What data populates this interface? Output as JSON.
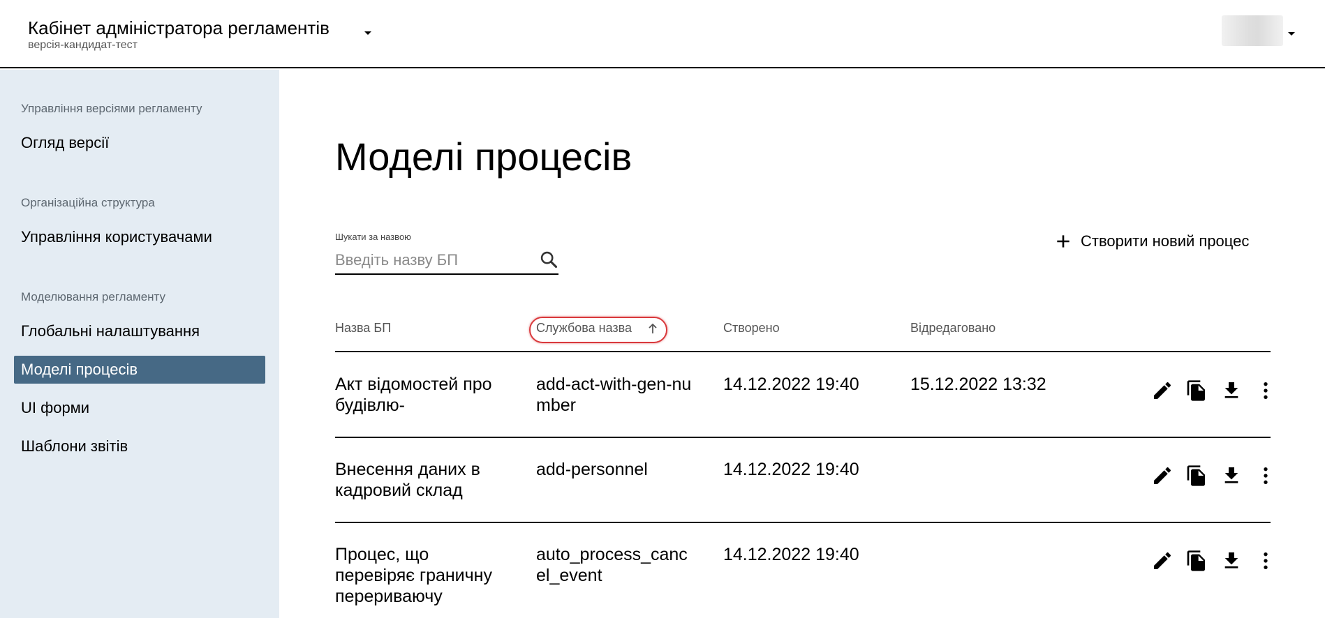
{
  "header": {
    "title": "Кабінет адміністратора регламентів",
    "subtitle": "версія-кандидат-тест"
  },
  "sidebar": {
    "sections": [
      {
        "label": "Управління версіями регламенту",
        "items": [
          "Огляд версії"
        ]
      },
      {
        "label": "Організаційна структура",
        "items": [
          "Управління користувачами"
        ]
      },
      {
        "label": "Моделювання регламенту",
        "items": [
          "Глобальні налаштування",
          "Моделі процесів",
          "UI форми",
          "Шаблони звітів"
        ]
      }
    ],
    "active_item": "Моделі процесів"
  },
  "main": {
    "title": "Моделі процесів",
    "search": {
      "label": "Шукати за назвою",
      "placeholder": "Введіть назву БП",
      "value": ""
    },
    "create_button": "Створити новий процес"
  },
  "table": {
    "columns": [
      "Назва БП",
      "Службова назва",
      "Створено",
      "Відредаговано"
    ],
    "sorted_column": "Службова назва",
    "sort_direction": "ascending",
    "rows": [
      {
        "name": "Акт відомостей про будівлю-",
        "service_name": "add-act-with-gen-number",
        "created": "14.12.2022 19:40",
        "edited": "15.12.2022 13:32"
      },
      {
        "name": "Внесення даних в кадровий склад",
        "service_name": "add-personnel",
        "created": "14.12.2022 19:40",
        "edited": ""
      },
      {
        "name": "Процес, що перевіряє граничну перериваючу",
        "service_name": "auto_process_cancel_event",
        "created": "14.12.2022 19:40",
        "edited": ""
      }
    ]
  },
  "colors": {
    "sidebar_bg": "#e4ecf3",
    "active_item_bg": "#466985",
    "sort_highlight": "#d9393c"
  },
  "icons": [
    "chevron-down-icon",
    "search-icon",
    "plus-icon",
    "arrow-up-icon",
    "edit-icon",
    "copy-icon",
    "download-icon",
    "more-vert-icon"
  ]
}
